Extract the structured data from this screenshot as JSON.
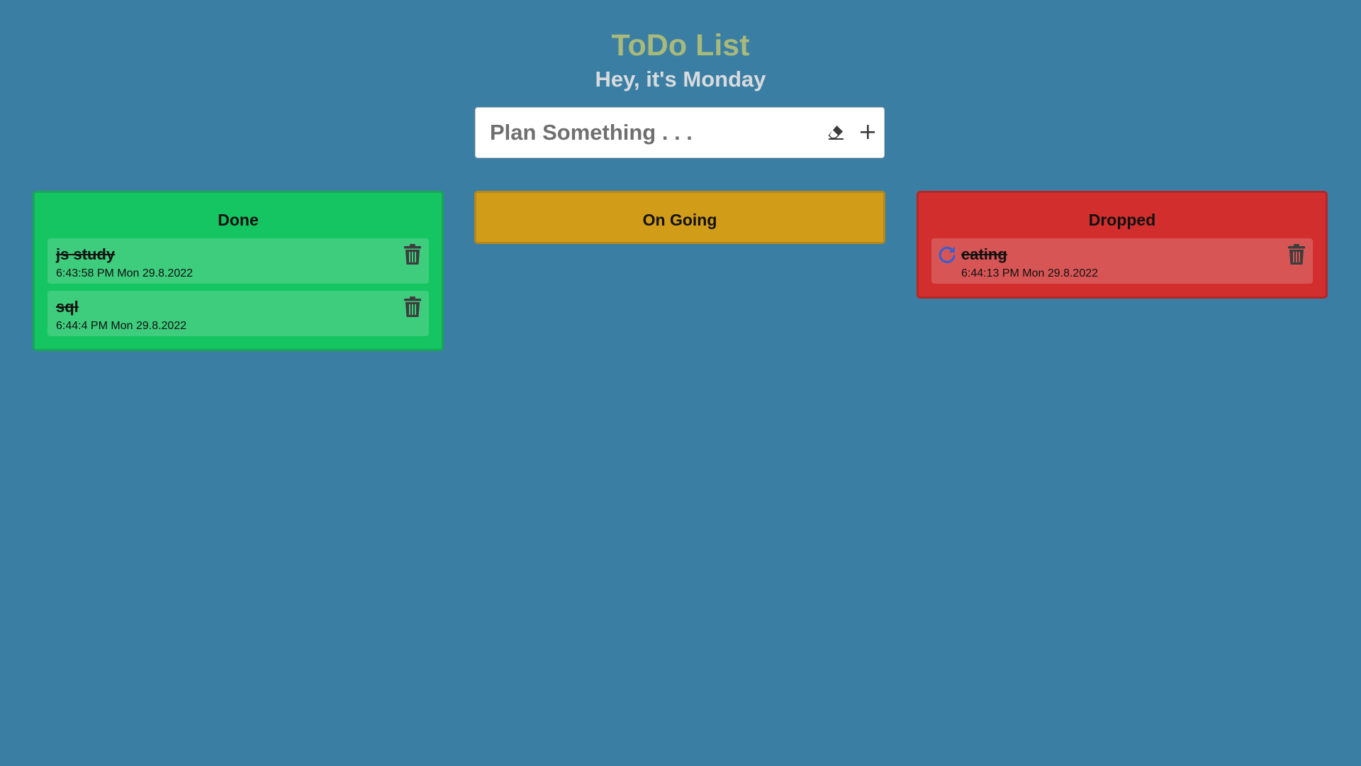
{
  "header": {
    "title": "ToDo List",
    "subtitle": "Hey, it's Monday"
  },
  "input": {
    "placeholder": "Plan Something . . .",
    "value": ""
  },
  "columns": {
    "done": {
      "label": "Done",
      "tasks": [
        {
          "name": "js study",
          "time": "6:43:58 PM Mon 29.8.2022"
        },
        {
          "name": "sql",
          "time": "6:44:4 PM Mon 29.8.2022"
        }
      ]
    },
    "ongoing": {
      "label": "On Going",
      "tasks": []
    },
    "dropped": {
      "label": "Dropped",
      "tasks": [
        {
          "name": "eating",
          "time": "6:44:13 PM Mon 29.8.2022"
        }
      ]
    }
  },
  "colors": {
    "background": "#3b7ea3",
    "title": "#a7ba7b",
    "done": "#14c562",
    "ongoing": "#d19c17",
    "dropped": "#d22e2e",
    "restore_icon": "#3a5fd0"
  },
  "icons": {
    "eraser": "eraser-icon",
    "add": "plus-icon",
    "delete": "trash-icon",
    "restore": "restore-icon"
  }
}
